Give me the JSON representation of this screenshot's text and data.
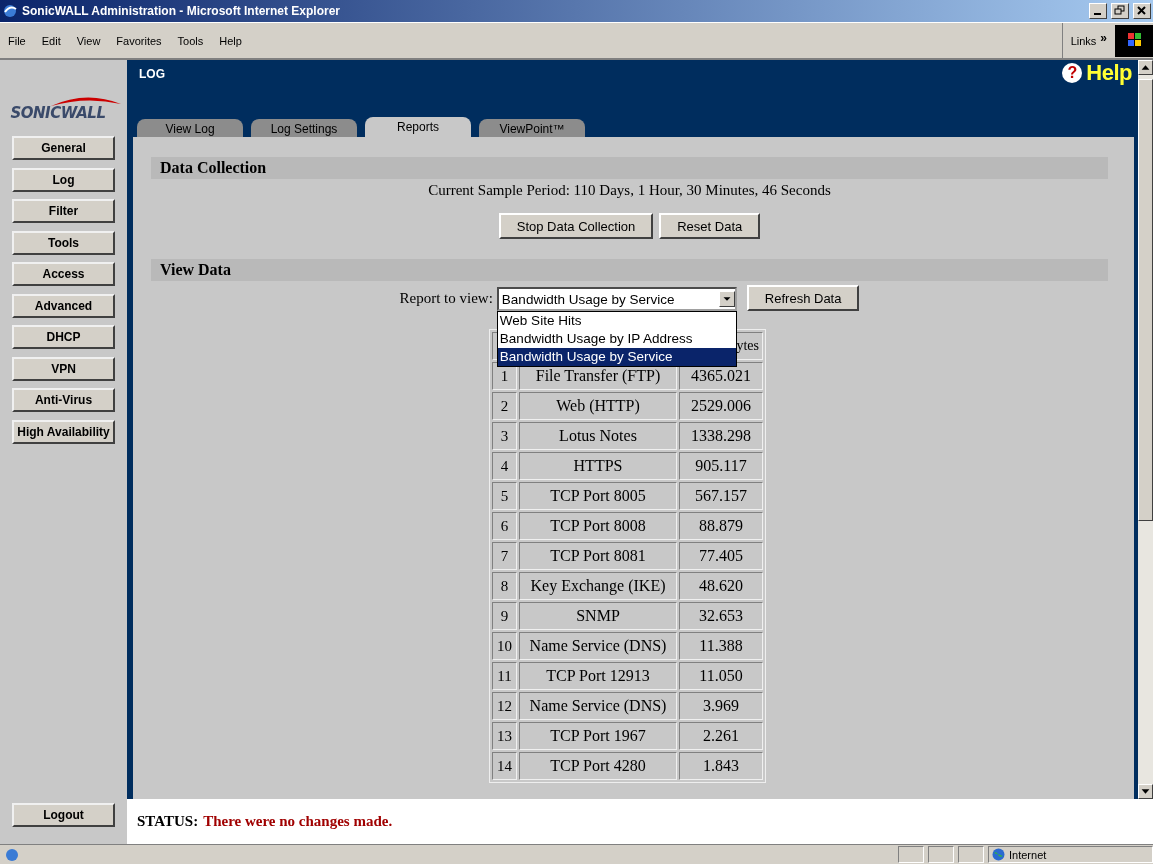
{
  "window": {
    "title": "SonicWALL Administration - Microsoft Internet Explorer"
  },
  "menu": [
    "File",
    "Edit",
    "View",
    "Favorites",
    "Tools",
    "Help"
  ],
  "links": {
    "label": "Links",
    "chevron": "»"
  },
  "sidebar": {
    "logo": "SONICWALL",
    "items": [
      "General",
      "Log",
      "Filter",
      "Tools",
      "Access",
      "Advanced",
      "DHCP",
      "VPN",
      "Anti-Virus",
      "High Availability"
    ],
    "logout": "Logout"
  },
  "header": {
    "title": "LOG",
    "help_glyph": "?",
    "help": "Help"
  },
  "tabs": [
    {
      "label": "View Log",
      "selected": false
    },
    {
      "label": "Log Settings",
      "selected": false
    },
    {
      "label": "Reports",
      "selected": true
    },
    {
      "label": "ViewPoint™",
      "selected": false
    }
  ],
  "data_collection": {
    "heading": "Data Collection",
    "sample_period": "Current Sample Period: 110 Days, 1 Hour, 30 Minutes, 46 Seconds",
    "buttons": [
      "Stop Data Collection",
      "Reset Data"
    ]
  },
  "view_data": {
    "heading": "View Data",
    "report_label": "Report to view:",
    "report_value": "Bandwidth Usage by Service",
    "refresh": "Refresh Data",
    "options": [
      {
        "label": "Web Site Hits",
        "selected": false
      },
      {
        "label": "Bandwidth Usage by IP Address",
        "selected": false
      },
      {
        "label": "Bandwidth Usage by Service",
        "selected": true
      }
    ]
  },
  "table": {
    "column_3_header": "ytes",
    "rows": [
      [
        "1",
        "File Transfer (FTP)",
        "4365.021"
      ],
      [
        "2",
        "Web (HTTP)",
        "2529.006"
      ],
      [
        "3",
        "Lotus Notes",
        "1338.298"
      ],
      [
        "4",
        "HTTPS",
        "905.117"
      ],
      [
        "5",
        "TCP Port 8005",
        "567.157"
      ],
      [
        "6",
        "TCP Port 8008",
        "88.879"
      ],
      [
        "7",
        "TCP Port 8081",
        "77.405"
      ],
      [
        "8",
        "Key Exchange (IKE)",
        "48.620"
      ],
      [
        "9",
        "SNMP",
        "32.653"
      ],
      [
        "10",
        "Name Service (DNS)",
        "11.388"
      ],
      [
        "11",
        "TCP Port 12913",
        "11.050"
      ],
      [
        "12",
        "Name Service (DNS)",
        "3.969"
      ],
      [
        "13",
        "TCP Port 1967",
        "2.261"
      ],
      [
        "14",
        "TCP Port 4280",
        "1.843"
      ]
    ]
  },
  "status": {
    "label": "STATUS:",
    "message": "There were no changes made."
  },
  "status_bar": {
    "zone": "Internet"
  }
}
